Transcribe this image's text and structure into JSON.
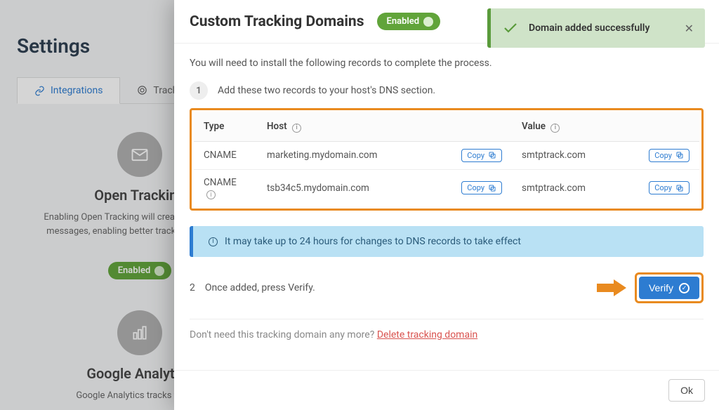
{
  "background": {
    "page_title": "Settings",
    "tabs": {
      "integrations": "Integrations",
      "tracking": "Tracking"
    },
    "cards": [
      {
        "title": "Open Tracking",
        "desc": "Enabling Open Tracking will create of your open messages, enabling better track campaign res",
        "toggle_label": "Enabled"
      },
      {
        "title": "Google Analytics",
        "desc": "Google Analytics tracks your ce"
      }
    ]
  },
  "modal": {
    "title": "Custom Tracking Domains",
    "status_pill": "Enabled",
    "toast": "Domain added successfully",
    "intro": "You will need to install the following records to complete the process.",
    "step1": "Add these two records to your host's DNS section.",
    "table": {
      "headers": {
        "type": "Type",
        "host": "Host",
        "value": "Value"
      },
      "rows": [
        {
          "type": "CNAME",
          "host": "marketing.mydomain.com",
          "value": "smtptrack.com"
        },
        {
          "type": "CNAME",
          "host": "tsb34c5.mydomain.com",
          "value": "smtptrack.com",
          "type_has_info": true
        }
      ],
      "copy_label": "Copy"
    },
    "alert": "It may take up to 24 hours for changes to DNS records to take effect",
    "step2": "Once added, press Verify.",
    "verify_label": "Verify",
    "delete_prompt": "Don't need this tracking domain any more?",
    "delete_link": "Delete tracking domain",
    "ok_label": "Ok"
  }
}
